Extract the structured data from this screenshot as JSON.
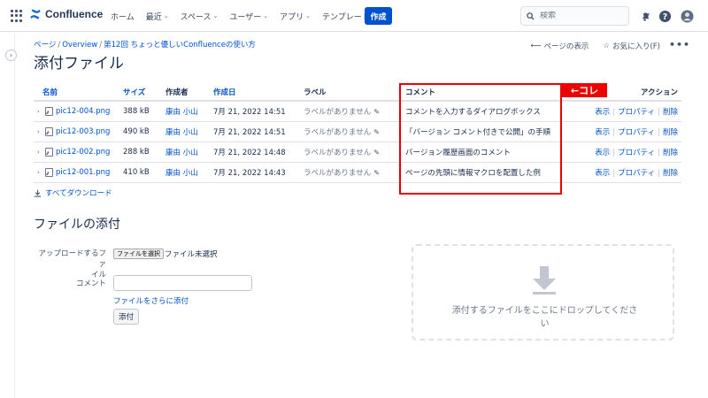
{
  "topnav": {
    "logo": "Confluence",
    "items": [
      {
        "label": "ホーム",
        "dropdown": false
      },
      {
        "label": "最近",
        "dropdown": true
      },
      {
        "label": "スペース",
        "dropdown": true
      },
      {
        "label": "ユーザー",
        "dropdown": true
      },
      {
        "label": "アプリ",
        "dropdown": true
      },
      {
        "label": "テンプレート",
        "dropdown": false
      }
    ],
    "create_label": "作成",
    "search_placeholder": "検索"
  },
  "breadcrumb": [
    "ページ",
    "Overview",
    "第12回 ちょっと優しいConfluenceの使い方"
  ],
  "page_actions": {
    "view_page": "ページの表示",
    "favorite": "お気に入り(F)",
    "more": "•••"
  },
  "page_title": "添付ファイル",
  "table": {
    "headers": {
      "name": "名前",
      "size": "サイズ",
      "creator": "作成者",
      "created": "作成日",
      "label": "ラベル",
      "comment": "コメント",
      "action": "アクション"
    },
    "rows": [
      {
        "name": "pic12-004.png",
        "size": "388 kB",
        "creator": "康由 小山",
        "created": "7月 21, 2022 14:51",
        "label": "ラベルがありません",
        "comment": "コメントを入力するダイアログボックス"
      },
      {
        "name": "pic12-003.png",
        "size": "490 kB",
        "creator": "康由 小山",
        "created": "7月 21, 2022 14:51",
        "label": "ラベルがありません",
        "comment": "「バージョン コメント付きで公開」の手順"
      },
      {
        "name": "pic12-002.png",
        "size": "288 kB",
        "creator": "康由 小山",
        "created": "7月 21, 2022 14:48",
        "label": "ラベルがありません",
        "comment": "バージョン履歴画面のコメント"
      },
      {
        "name": "pic12-001.png",
        "size": "410 kB",
        "creator": "康由 小山",
        "created": "7月 21, 2022 14:43",
        "label": "ラベルがありません",
        "comment": "ページの先頭に情報マクロを配置した例"
      }
    ],
    "actions": {
      "view": "表示",
      "properties": "プロパティ",
      "delete": "削除"
    }
  },
  "annotation": {
    "tag": "←コレ",
    "color": "#e00000"
  },
  "download_all": "すべてダウンロード",
  "attach_section": {
    "title": "ファイルの添付",
    "upload_label_line1": "アップロードするファ",
    "upload_label_line2": "イル",
    "choose_file": "ファイルを選択",
    "no_file": "ファイル未選択",
    "comment_label": "コメント",
    "add_more": "ファイルをさらに添付",
    "attach_button": "添付",
    "drop_text": "添付するファイルをここにドロップしてください"
  },
  "colors": {
    "link": "#0052cc",
    "primary": "#0052cc",
    "text": "#172b4d"
  }
}
